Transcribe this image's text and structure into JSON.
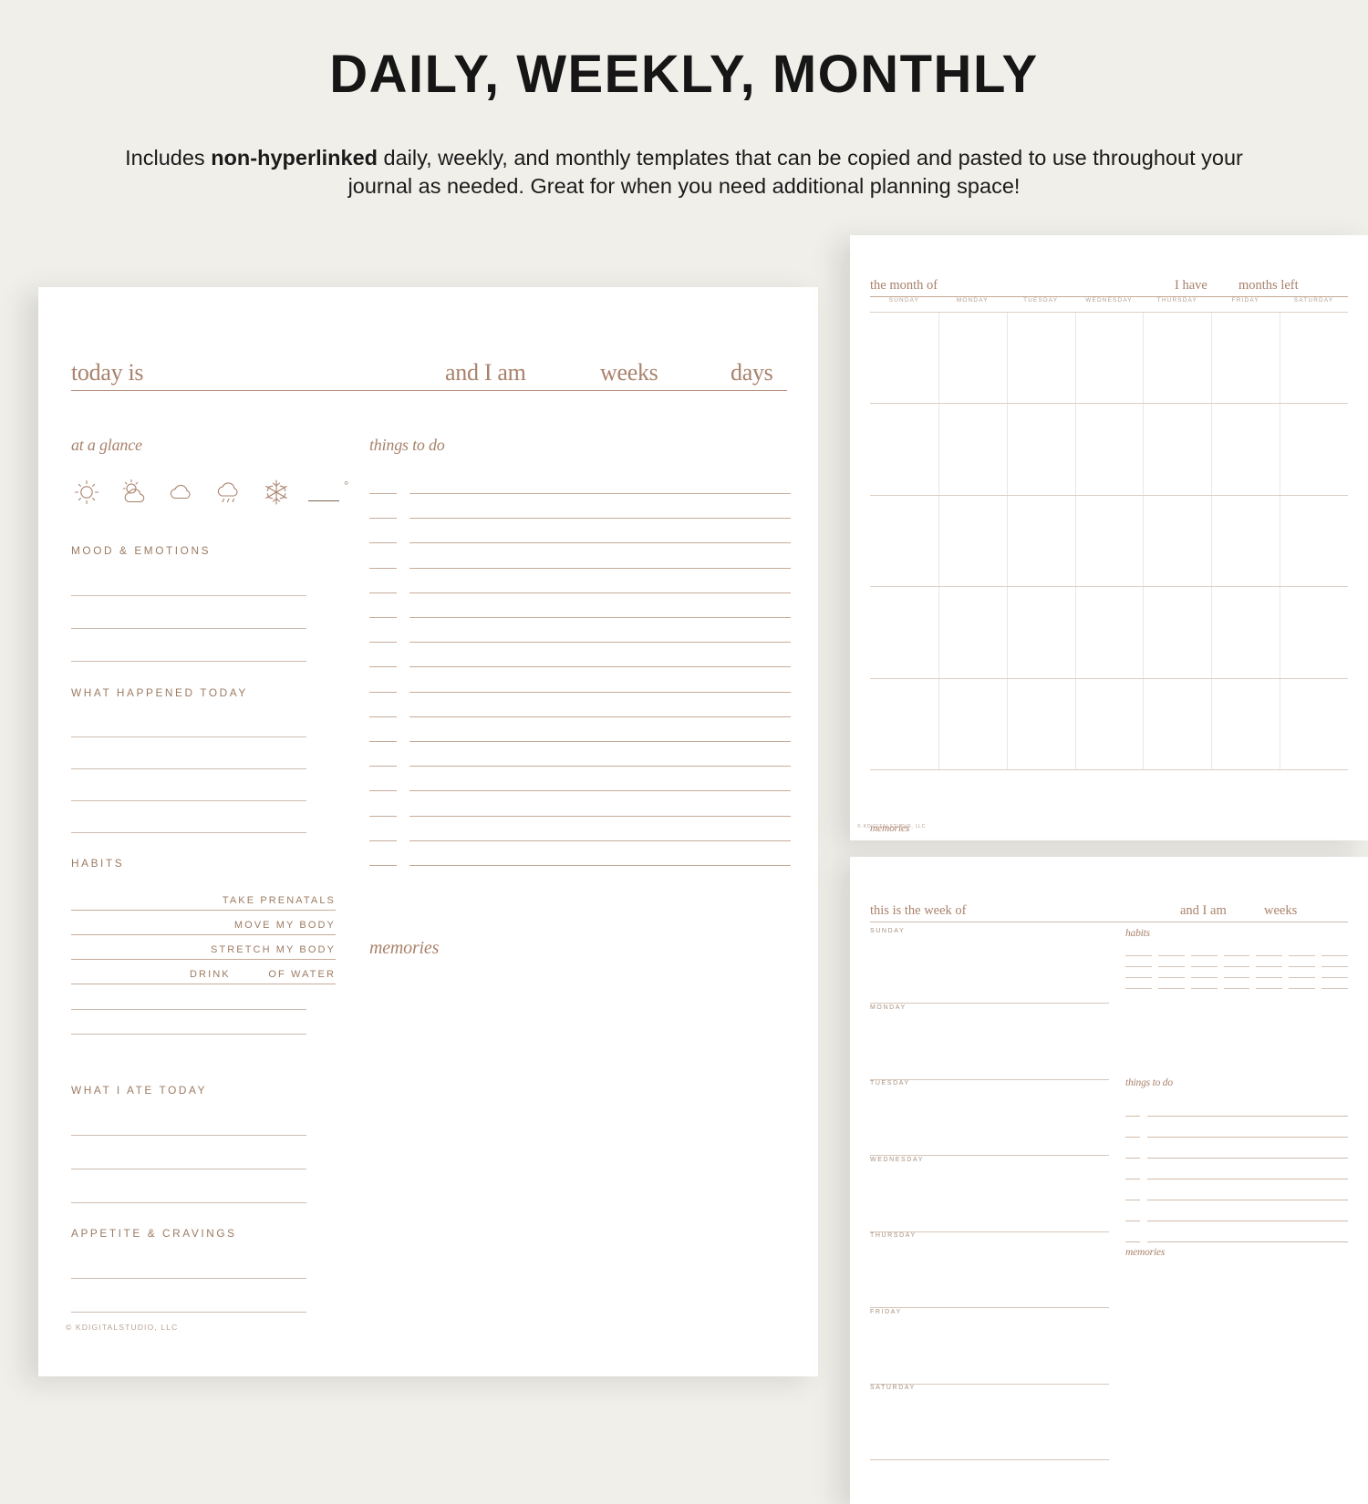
{
  "banner": {
    "title": "DAILY, WEEKLY, MONTHLY",
    "subtitle_part1": "Includes ",
    "subtitle_bold": "non-hyperlinked",
    "subtitle_part2": " daily, weekly, and monthly templates that can be copied and pasted to use throughout your journal as needed. Great for when you need additional planning space!"
  },
  "daily": {
    "header": {
      "today_is": "today is",
      "and_i_am": "and I am",
      "weeks": "weeks",
      "days": "days"
    },
    "at_a_glance_label": "at a glance",
    "weather_icons": [
      "sun-icon",
      "sun-behind-cloud-icon",
      "cloud-icon",
      "rain-cloud-icon",
      "snowflake-icon",
      "temperature-blank-icon"
    ],
    "degree_symbol": "°",
    "sections": [
      {
        "label": "MOOD & EMOTIONS",
        "lines": 3
      },
      {
        "label": "WHAT HAPPENED TODAY",
        "lines": 4
      },
      {
        "label": "HABITS",
        "lines": 2
      },
      {
        "label": "WHAT I ATE TODAY",
        "lines": 3
      },
      {
        "label": "APPETITE & CRAVINGS",
        "lines": 2
      }
    ],
    "habits": [
      {
        "label": "TAKE PRENATALS",
        "align": "right"
      },
      {
        "label": "MOVE MY BODY",
        "align": "right"
      },
      {
        "label": "STRETCH MY BODY",
        "align": "right"
      },
      {
        "label_left": "DRINK",
        "label_right": "OF WATER",
        "align": "split"
      }
    ],
    "things_to_do_label": "things to do",
    "things_to_do_rows": 16,
    "memories_label": "memories",
    "copyright": "© KDIGITALSTUDIO, LLC"
  },
  "monthly": {
    "header": {
      "the_month_of": "the month of",
      "i_have": "I have",
      "months_left": "months left"
    },
    "day_headers": [
      "SUNDAY",
      "MONDAY",
      "TUESDAY",
      "WEDNESDAY",
      "THURSDAY",
      "FRIDAY",
      "SATURDAY"
    ],
    "weeks_rows": 5,
    "memories_label": "memories",
    "copyright": "© KDIGITALSTUDIO, LLC"
  },
  "weekly": {
    "header": {
      "this_is_the_week_of": "this is the week of",
      "and_i_am": "and I am",
      "weeks": "weeks"
    },
    "days": [
      "SUNDAY",
      "MONDAY",
      "TUESDAY",
      "WEDNESDAY",
      "THURSDAY",
      "FRIDAY",
      "SATURDAY"
    ],
    "habits_label": "habits",
    "habits_grid_rows": 4,
    "habits_grid_cols": 7,
    "things_to_do_label": "things to do",
    "things_to_do_rows": 7,
    "memories_label": "memories"
  },
  "colors": {
    "page_background": "#f0efea",
    "paper": "#ffffff",
    "accent_brown": "#a9826c",
    "rule": "#c6ab99",
    "caps_text": "#9d7b63",
    "title_black": "#161616"
  }
}
